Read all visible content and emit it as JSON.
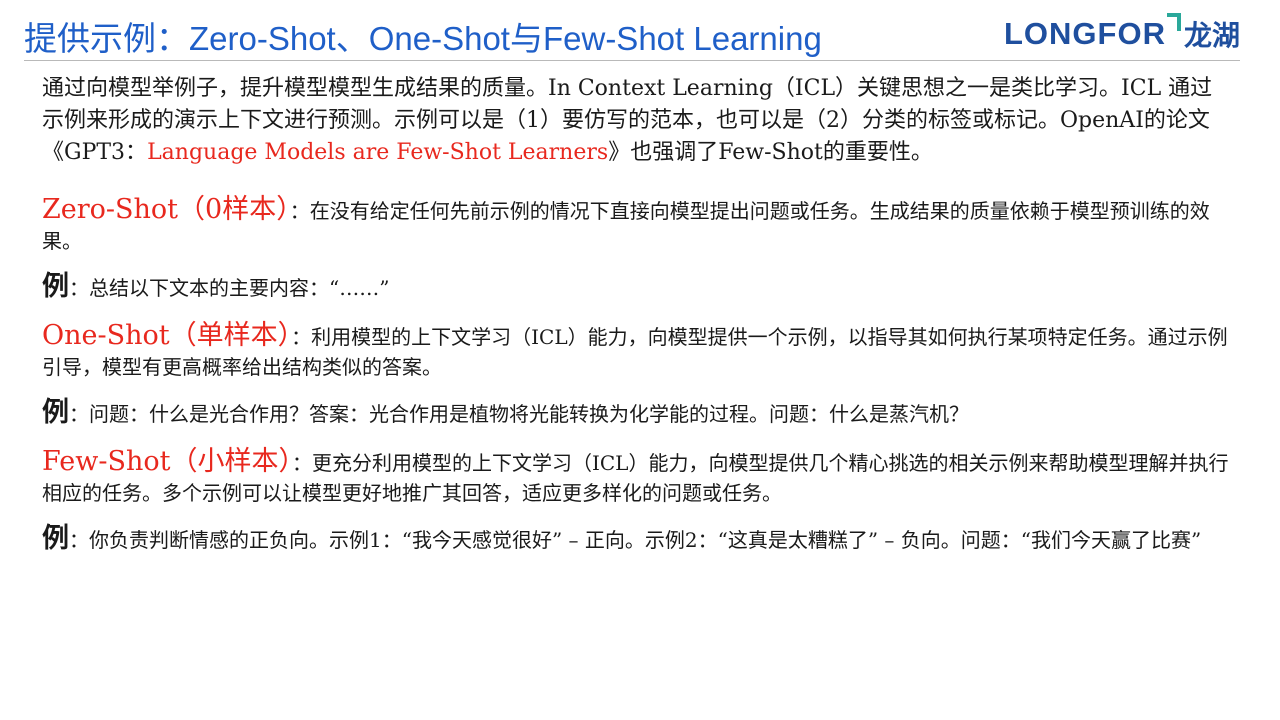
{
  "header": {
    "title": "提供示例：Zero-Shot、One-Shot与Few-Shot Learning",
    "logo_text": "LONGFOR",
    "logo_cn": "龙湖"
  },
  "intro": {
    "part1": "通过向模型举例子，提升模型模型生成结果的质量。In Context Learning（ICL）关键思想之一是类比学习。ICL 通过示例来形成的演示上下文进行预测。示例可以是（1）要仿写的范本，也可以是（2）分类的标签或标记。OpenAI的论文《GPT3：",
    "highlight": "Language Models are Few-Shot Learners",
    "part2": "》也强调了Few-Shot的重要性。"
  },
  "sections": [
    {
      "term": "Zero-Shot（0样本）",
      "sep": "：",
      "description": "在没有给定任何先前示例的情况下直接向模型提出问题或任务。生成结果的质量依赖于模型预训练的效果。",
      "example_label": "例",
      "example_sep": "：",
      "example_text": "总结以下文本的主要内容：“……”"
    },
    {
      "term": "One-Shot（单样本）",
      "sep": "：",
      "description": "利用模型的上下文学习（ICL）能力，向模型提供一个示例，以指导其如何执行某项特定任务。通过示例引导，模型有更高概率给出结构类似的答案。",
      "example_label": "例",
      "example_sep": "：",
      "example_text": "问题：什么是光合作用？答案：光合作用是植物将光能转换为化学能的过程。问题：什么是蒸汽机？"
    },
    {
      "term": "Few-Shot（小样本）",
      "sep": "：",
      "description": "更充分利用模型的上下文学习（ICL）能力，向模型提供几个精心挑选的相关示例来帮助模型理解并执行相应的任务。多个示例可以让模型更好地推广其回答，适应更多样化的问题或任务。",
      "example_label": "例",
      "example_sep": "：",
      "example_text": "你负责判断情感的正负向。示例1：“我今天感觉很好” – 正向。示例2：“这真是太糟糕了” – 负向。问题：“我们今天赢了比赛”"
    }
  ],
  "colors": {
    "title": "#1f5fc8",
    "accent": "#e8281e",
    "logo": "#1f4f9e",
    "logo_mark": "#2aa89a"
  }
}
